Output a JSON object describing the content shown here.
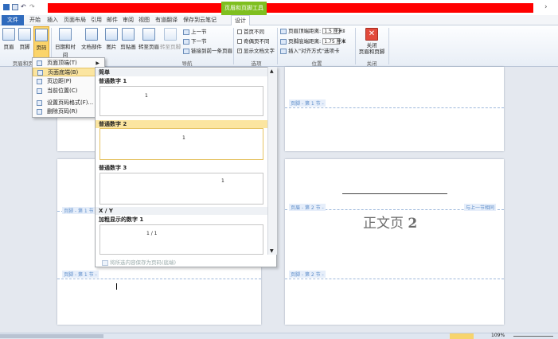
{
  "titlebar": {
    "context_tab": "页眉和页脚工具"
  },
  "tabs": [
    "文件",
    "开始",
    "插入",
    "页面布局",
    "引用",
    "邮件",
    "审阅",
    "视图",
    "有道翻译",
    "保存到云笔记",
    "设计"
  ],
  "ribbon": {
    "header_btn": "页眉",
    "footer_btn": "页脚",
    "page_num_btn": "页码",
    "group_header_footer": "页眉和页脚",
    "datetime_btn": "日期和时间",
    "docparts_btn": "文档部件",
    "picture_btn": "图片",
    "clipart_btn": "剪贴画",
    "goto_header_btn": "转至页眉",
    "goto_footer_btn": "转至页脚",
    "prev_btn": "上一节",
    "next_btn": "下一节",
    "link_prev_btn": "链接到前一条页眉",
    "group_nav": "导航",
    "diff_first": "首页不同",
    "diff_odd_even": "奇偶页不同",
    "show_doc_text": "显示文档文字",
    "group_options": "选项",
    "header_top_label": "页眉顶端距离:",
    "header_top_value": "1.5 厘米",
    "footer_bottom_label": "页脚底端距离:",
    "footer_bottom_value": "1.75 厘米",
    "insert_align_tab": "插入\"对齐方式\"选项卡",
    "group_position": "位置",
    "close_btn": "关闭\n页眉和页脚",
    "group_close": "关闭"
  },
  "menu": {
    "items": [
      "页面顶端(T)",
      "页面底端(B)",
      "页边距(P)",
      "当前位置(C)",
      "设置页码格式(F)...",
      "删除页码(R)"
    ]
  },
  "gallery": {
    "section_simple": "简单",
    "item1": "普通数字 1",
    "item2": "普通数字 2",
    "item3": "普通数字 3",
    "section_xy": "X / Y",
    "item4": "加粗显示的数字 1",
    "sample_num": "1",
    "sample_xy": "1 / 1",
    "save_selection": "将所选内容保存为页码(底端)"
  },
  "pages": {
    "footer_label_1": "页脚 - 第 1 节 -",
    "header_label_2": "页眉 - 第 2 节 -",
    "footer_label_2": "页脚 - 第 2 节 -",
    "same_as_prev": "与上一节相同",
    "body_text": "正文页",
    "body_num": "2"
  },
  "status": {
    "zoom": "109%"
  },
  "colors": {
    "accent": "#2f6bbd",
    "context_green": "#7fbf1f",
    "highlight": "#fbe5a0"
  }
}
